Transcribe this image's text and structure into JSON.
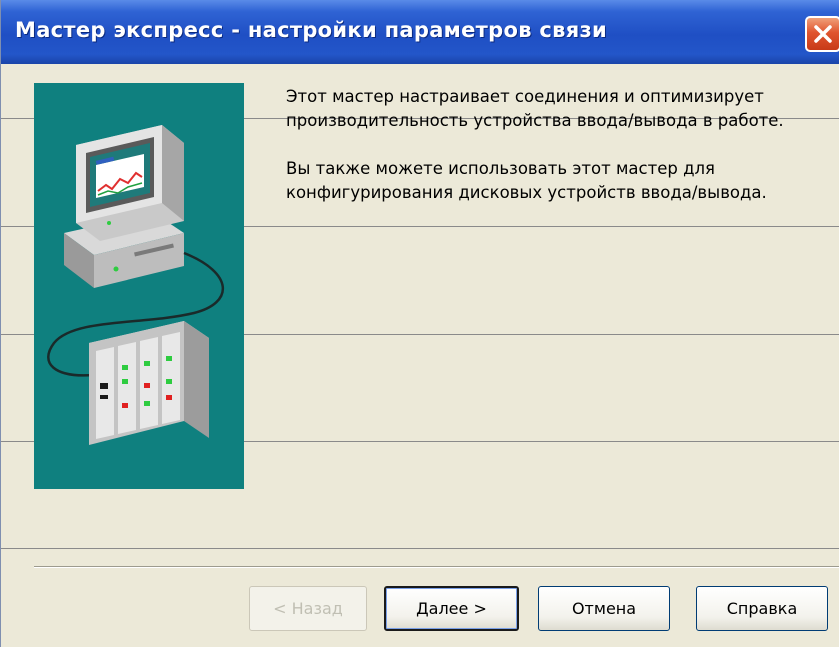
{
  "window": {
    "title": "Мастер экспресс - настройки параметров связи"
  },
  "description": {
    "paragraph1": "Этот мастер настраивает соединения  и оптимизирует производительность устройства ввода/вывода в работе.",
    "paragraph2": "Вы также можете использовать этот мастер для конфигурирования дисковых устройств ввода/вывода."
  },
  "buttons": {
    "back": "< Назад",
    "next": "Далее >",
    "cancel": "Отмена",
    "help": "Справка"
  },
  "colors": {
    "banner": "#0f807f",
    "titlebar": "#1f4fc4",
    "dialog": "#ECE9D8"
  },
  "icons": {
    "close": "close-icon",
    "illustration": "computer-io-device-illustration"
  }
}
